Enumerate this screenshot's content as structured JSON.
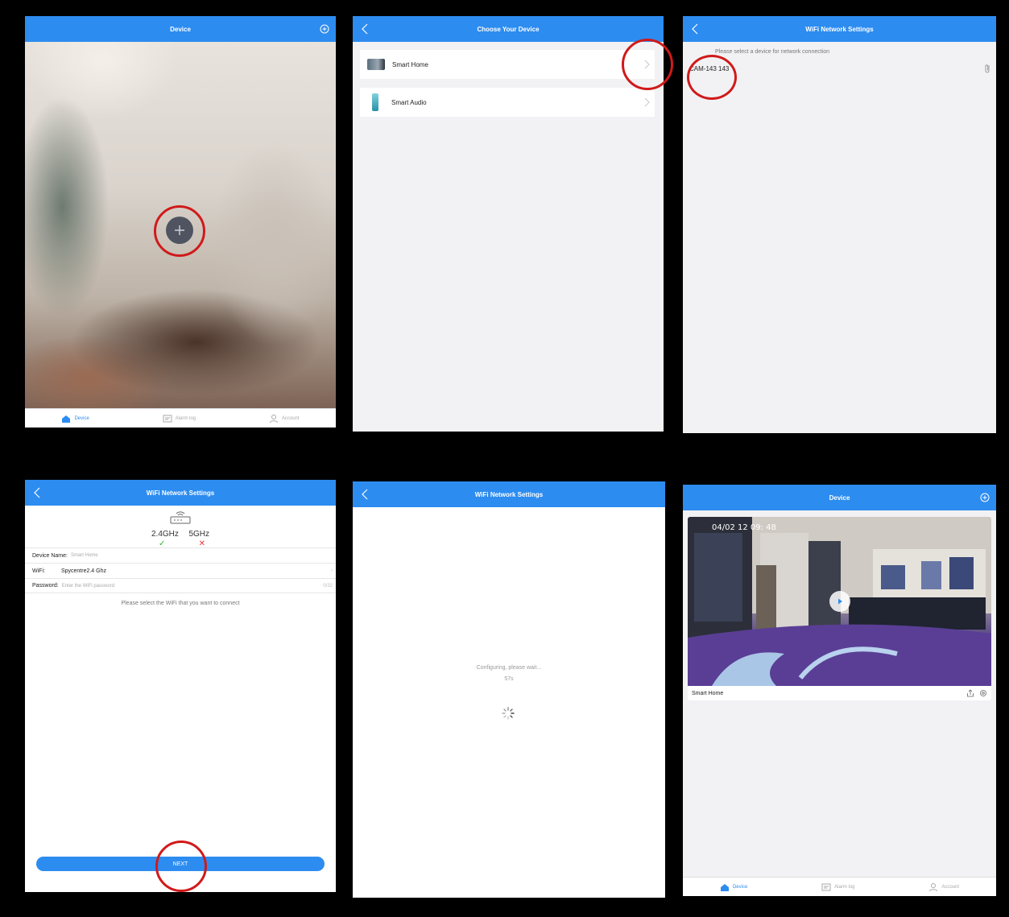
{
  "panel1": {
    "title": "Device",
    "tabs": [
      {
        "label": "Device",
        "icon": "home-icon"
      },
      {
        "label": "Alarm log",
        "icon": "message-icon"
      },
      {
        "label": "Account",
        "icon": "person-icon"
      }
    ]
  },
  "panel2": {
    "title": "Choose Your Device",
    "rows": [
      {
        "label": "Smart Home"
      },
      {
        "label": "Smart Audio"
      }
    ]
  },
  "panel3": {
    "title": "WiFi Network Settings",
    "hint": "Please select a device for network connection",
    "device": "CAM-143 143"
  },
  "panel4": {
    "title": "WiFi Network Settings",
    "bands": [
      "2.4GHz",
      "5GHz"
    ],
    "marks": [
      "✓",
      "✕"
    ],
    "device_name_label": "Device Name:",
    "device_name_value": "Smart Home",
    "wifi_label": "WiFi:",
    "wifi_value": "Spycentre2.4 Ghz",
    "password_label": "Password:",
    "password_placeholder": "Enter the WiFi password",
    "password_counter": "0/32",
    "message": "Please select the WiFi that you want to connect",
    "next": "NEXT"
  },
  "panel5": {
    "title": "WiFi Network Settings",
    "status": "Configuring, please wait...",
    "countdown": "57s"
  },
  "panel6": {
    "title": "Device",
    "camera_name": "Smart Home",
    "timestamp": "04/02 12 09: 48",
    "tabs": [
      {
        "label": "Device",
        "icon": "home-icon"
      },
      {
        "label": "Alarm log",
        "icon": "message-icon"
      },
      {
        "label": "Account",
        "icon": "person-icon"
      }
    ]
  },
  "colors": {
    "accent": "#2d8cf0",
    "annotation": "#d01a1a",
    "background": "#000000"
  }
}
